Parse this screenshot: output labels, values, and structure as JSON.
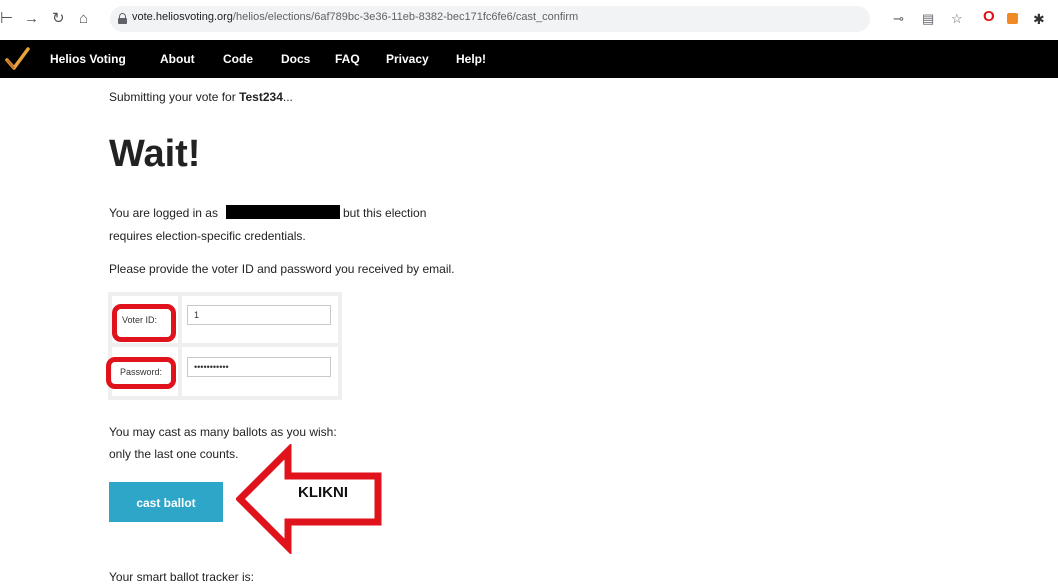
{
  "browser": {
    "url_domain": "vote.heliosvoting.org",
    "url_path": "/helios/elections/6af789bc-3e36-11eb-8382-bec171fc6fe6/cast_confirm"
  },
  "navbar": {
    "items": [
      "Helios Voting",
      "About",
      "Code",
      "Docs",
      "FAQ",
      "Privacy",
      "Help!"
    ]
  },
  "content": {
    "submitting_prefix": "Submitting your vote for ",
    "election_name": "Test234",
    "submitting_suffix": "...",
    "heading": "Wait!",
    "logged_in_prefix": "You are logged in as",
    "logged_in_suffix": "but this election",
    "credentials_line": "requires election-specific credentials.",
    "provide_line": "Please provide the voter ID and password you received by email.",
    "voter_id_label": "Voter ID:",
    "voter_id_value": "1",
    "password_label": "Password:",
    "password_value": "•••••••••••",
    "cast_many_line1": "You may cast as many ballots as you wish:",
    "cast_many_line2": "only the last one counts.",
    "cast_button": "cast ballot",
    "annotation": "KLIKNI",
    "tracker_line": "Your smart ballot tracker is:"
  },
  "colors": {
    "navbar": "#000000",
    "button": "#2ea6c8",
    "annotation_red": "#e0121b"
  }
}
